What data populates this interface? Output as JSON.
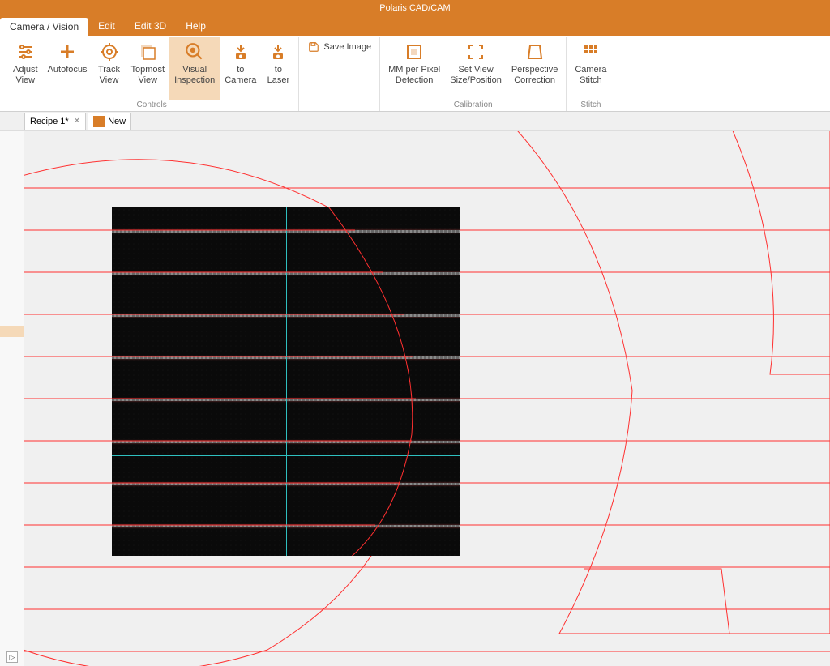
{
  "app": {
    "title": "Polaris CAD/CAM"
  },
  "menu": {
    "tabs": [
      {
        "label": "Camera / Vision",
        "active": true
      },
      {
        "label": "Edit"
      },
      {
        "label": "Edit 3D"
      },
      {
        "label": "Help"
      }
    ]
  },
  "ribbon": {
    "adjust_view": "Adjust\nView",
    "autofocus": "Autofocus",
    "track_view": "Track\nView",
    "topmost_view": "Topmost\nView",
    "visual_inspection": "Visual\nInspection",
    "to_camera": "to\nCamera",
    "to_laser": "to\nLaser",
    "save_image": "Save Image",
    "mm_per_pixel": "MM per Pixel\nDetection",
    "set_view": "Set View\nSize/Position",
    "perspective": "Perspective\nCorrection",
    "camera_stitch": "Camera\nStitch",
    "group_controls": "Controls",
    "group_calibration": "Calibration",
    "group_stitch": "Stitch"
  },
  "doc_tabs": {
    "recipe": "Recipe 1*",
    "new": "New"
  },
  "colors": {
    "accent_orange": "#d87d28",
    "cad_line": "#ff3030",
    "crosshair": "#2fc0c0"
  }
}
